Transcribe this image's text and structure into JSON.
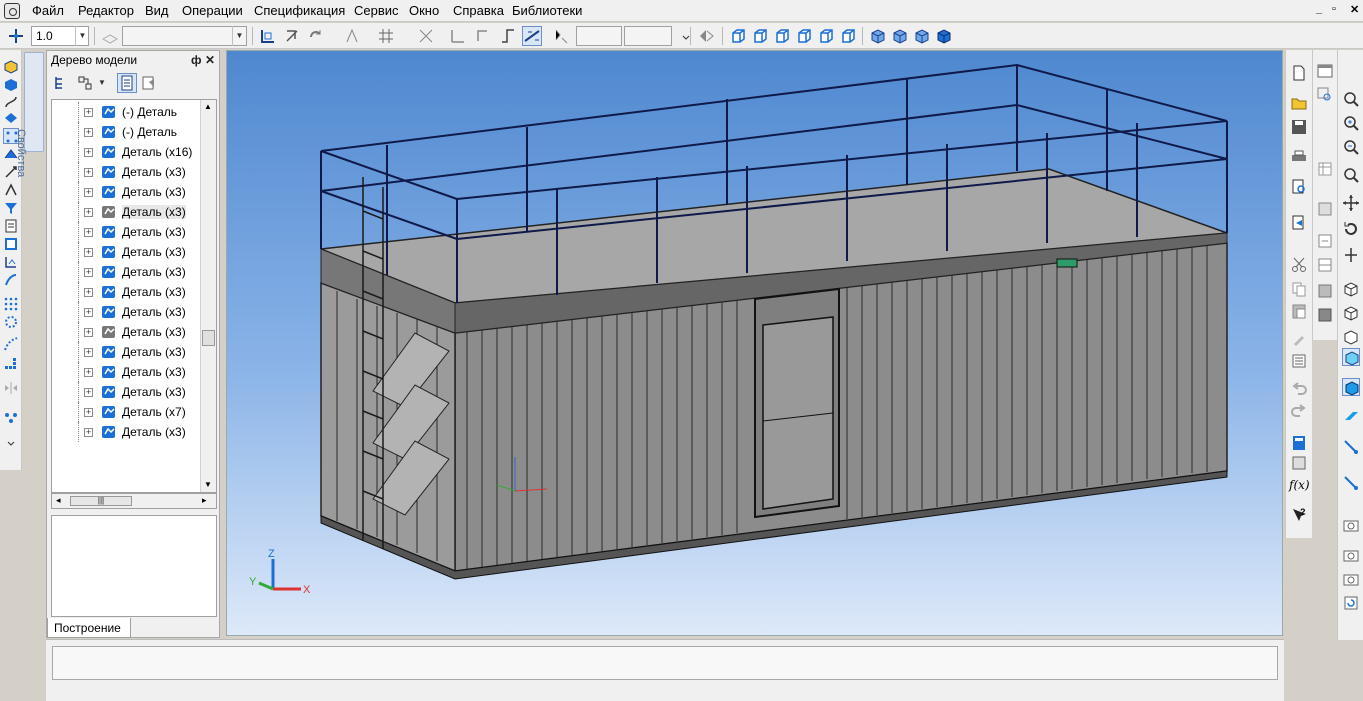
{
  "menu": {
    "items": [
      "Файл",
      "Редактор",
      "Вид",
      "Операции",
      "Спецификация",
      "Сервис",
      "Окно",
      "Справка",
      "Библиотеки"
    ]
  },
  "toolbar": {
    "scale_value": "1.0"
  },
  "sidebar_tab": {
    "label": "Свойства"
  },
  "tree": {
    "title": "Дерево модели",
    "pin_glyph": "ф",
    "close_glyph": "✕",
    "items": [
      {
        "label": "(-) Деталь",
        "icon": "part-icon",
        "color": "#1c6fd6"
      },
      {
        "label": "(-) Деталь",
        "icon": "part-icon",
        "color": "#1c6fd6"
      },
      {
        "label": "Деталь (x16)",
        "icon": "part-icon",
        "color": "#1c6fd6"
      },
      {
        "label": "Деталь (x3)",
        "icon": "part-icon",
        "color": "#1c6fd6"
      },
      {
        "label": "Деталь (x3)",
        "icon": "part-icon",
        "color": "#1c6fd6"
      },
      {
        "label": "Деталь (x3)",
        "icon": "part-icon",
        "color": "#777777"
      },
      {
        "label": "Деталь (x3)",
        "icon": "part-icon",
        "color": "#1c6fd6"
      },
      {
        "label": "Деталь (x3)",
        "icon": "part-icon",
        "color": "#1c6fd6"
      },
      {
        "label": "Деталь (x3)",
        "icon": "part-icon",
        "color": "#1c6fd6"
      },
      {
        "label": "Деталь (x3)",
        "icon": "part-icon",
        "color": "#1c6fd6"
      },
      {
        "label": "Деталь (x3)",
        "icon": "part-icon",
        "color": "#1c6fd6"
      },
      {
        "label": "Деталь (x3)",
        "icon": "part-icon",
        "color": "#777777"
      },
      {
        "label": "Деталь (x3)",
        "icon": "part-icon",
        "color": "#1c6fd6"
      },
      {
        "label": "Деталь (x3)",
        "icon": "part-icon",
        "color": "#1c6fd6"
      },
      {
        "label": "Деталь (x3)",
        "icon": "part-icon",
        "color": "#1c6fd6"
      },
      {
        "label": "Деталь (x7)",
        "icon": "part-icon",
        "color": "#1c6fd6"
      },
      {
        "label": "Деталь (x3)",
        "icon": "part-icon",
        "color": "#1c6fd6"
      }
    ],
    "tab_label": "Построение"
  },
  "viewport": {
    "axis_x": "X",
    "axis_y": "Y",
    "axis_z": "Z"
  },
  "right_toolbar": {
    "function_label": "f(x)"
  },
  "colors": {
    "accent": "#1c6fd6",
    "viewport_top": "#4f88d0",
    "viewport_bottom": "#dde9f9"
  }
}
